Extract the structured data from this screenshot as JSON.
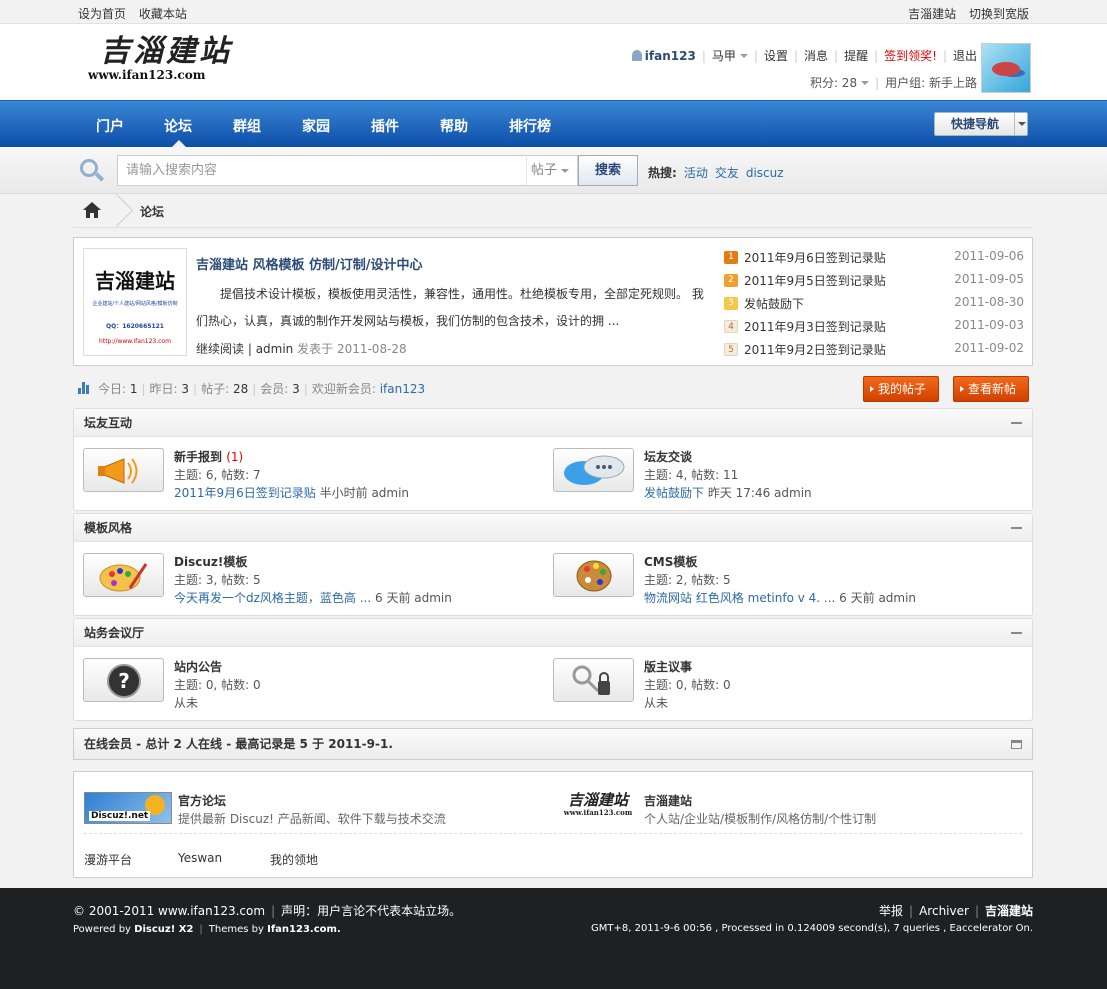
{
  "topbar": {
    "set_home": "设为首页",
    "bookmark": "收藏本站",
    "site_name": "吉淄建站",
    "switch_width": "切换到宽版"
  },
  "header": {
    "logo_text": "吉淄建站",
    "logo_url": "www.ifan123.com",
    "username": "ifan123",
    "horse": "马甲",
    "settings": "设置",
    "messages": "消息",
    "reminders": "提醒",
    "signin": "签到领奖!",
    "logout": "退出",
    "points_label": "积分: 28",
    "usergroup": "用户组: 新手上路"
  },
  "nav": {
    "items": [
      "门户",
      "论坛",
      "群组",
      "家园",
      "插件",
      "帮助",
      "排行榜"
    ],
    "quick_nav": "快捷导航"
  },
  "search": {
    "placeholder": "请输入搜索内容",
    "scope": "帖子",
    "button": "搜索",
    "hot_label": "热搜:",
    "hot": [
      "活动",
      "交友",
      "discuz"
    ]
  },
  "breadcrumb": {
    "current": "论坛"
  },
  "feature": {
    "image": {
      "title": "吉淄建站",
      "line": "企业建站/个人建站/网站风格/模板仿制",
      "qq": "QQ：1620665121",
      "url": "http://www.ifan123.com"
    },
    "title": "吉淄建站 风格模板 仿制/订制/设计中心",
    "desc": "提倡技术设计模板，模板使用灵活性，兼容性，通用性。杜绝模板专用，全部定死规则。 我们热心，认真，真诚的制作开发网站与模板，我们仿制的包含技术，设计的拥 ...",
    "read_more": "继续阅读",
    "author": "admin",
    "posted": "发表于 2011-08-28",
    "list": [
      {
        "num": "1",
        "title": "2011年9月6日签到记录贴",
        "date": "2011-09-06"
      },
      {
        "num": "2",
        "title": "2011年9月5日签到记录贴",
        "date": "2011-09-05"
      },
      {
        "num": "3",
        "title": "发帖鼓励下",
        "date": "2011-08-30"
      },
      {
        "num": "4",
        "title": "2011年9月3日签到记录贴",
        "date": "2011-09-03"
      },
      {
        "num": "5",
        "title": "2011年9月2日签到记录贴",
        "date": "2011-09-02"
      }
    ]
  },
  "stats": {
    "today": "今日: ",
    "today_v": "1",
    "yesterday": "昨日: ",
    "yesterday_v": "3",
    "posts": "帖子: ",
    "posts_v": "28",
    "members": "会员: ",
    "members_v": "3",
    "welcome": "欢迎新会员: ",
    "new_member": "ifan123",
    "my_posts": "我的帖子",
    "new_posts": "查看新帖"
  },
  "groups": [
    {
      "title": "坛友互动",
      "forums": [
        {
          "name": "新手报到",
          "extra": "(1)",
          "counts": "主题: 6, 帖数: 7",
          "last_link": "2011年9月6日签到记录贴",
          "last_meta": " 半小时前 admin"
        },
        {
          "name": "坛友交谈",
          "extra": "",
          "counts": "主题: 4, 帖数: 11",
          "last_link": "发帖鼓励下",
          "last_meta": " 昨天 17:46 admin"
        }
      ]
    },
    {
      "title": "模板风格",
      "forums": [
        {
          "name": "Discuz!模板",
          "extra": "",
          "counts": "主题: 3, 帖数: 5",
          "last_link": "今天再发一个dz风格主题，蓝色高 ...",
          "last_meta": " 6 天前 admin"
        },
        {
          "name": "CMS模板",
          "extra": "",
          "counts": "主题: 2, 帖数: 5",
          "last_link": "物流网站 红色风格 metinfo v 4. ...",
          "last_meta": " 6 天前 admin"
        }
      ]
    },
    {
      "title": "站务会议厅",
      "forums": [
        {
          "name": "站内公告",
          "extra": "",
          "counts": "主题: 0, 帖数: 0",
          "last_link": "",
          "last_meta": "从未"
        },
        {
          "name": "版主议事",
          "extra": "",
          "counts": "主题: 0, 帖数: 0",
          "last_link": "",
          "last_meta": "从未"
        }
      ]
    }
  ],
  "online": {
    "text": "在线会员 - 总计 2 人在线 - 最高记录是 5 于 2011-9-1."
  },
  "links": {
    "items": [
      {
        "logo": "Discuz!.net",
        "name": "官方论坛",
        "desc": "提供最新 Discuz! 产品新闻、软件下载与技术交流"
      },
      {
        "logo": "吉淄建站",
        "logo_url": "www.ifan123.com",
        "name": "吉淄建站",
        "desc": "个人站/企业站/模板制作/风格仿制/个性订制"
      }
    ],
    "text_links": [
      "漫游平台",
      "Yeswan",
      "我的领地"
    ]
  },
  "footer": {
    "copyright": "© 2001-2011 www.ifan123.com",
    "disclaimer": "声明：用户言论不代表本站立场。",
    "powered": "Powered by ",
    "discuz": "Discuz! X2",
    "themes": "Themes by ",
    "themes_site": "Ifan123.com.",
    "report": "举报",
    "archiver": "Archiver",
    "site": "吉淄建站",
    "stats_line": "GMT+8, 2011-9-6 00:56 , Processed in 0.124009 second(s), 7 queries , Eaccelerator On."
  },
  "colors": {
    "nav": "#0c4fa8",
    "accent_orange": "#d14000",
    "link": "#2b6aa8",
    "footer": "#1e2022"
  }
}
